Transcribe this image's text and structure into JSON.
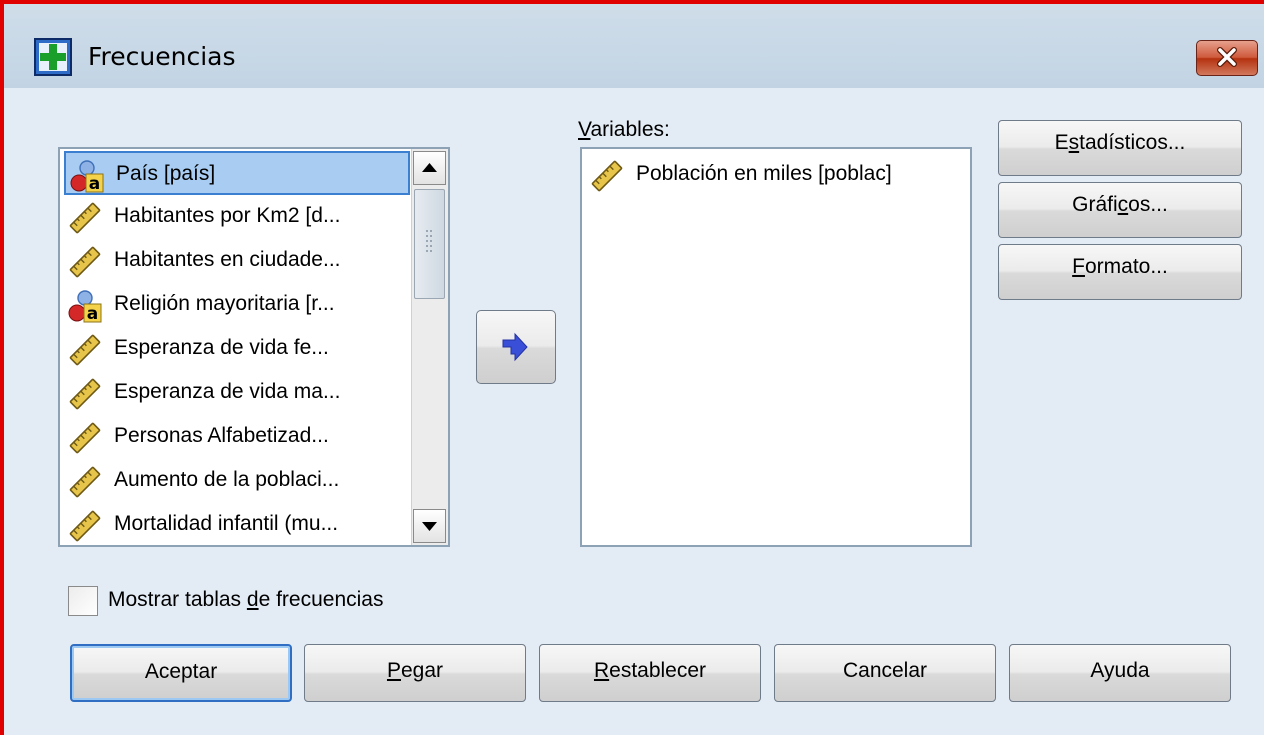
{
  "window": {
    "title": "Frecuencias",
    "icon": "frequencies-icon",
    "close_icon": "close-icon"
  },
  "source_list": {
    "items": [
      {
        "label": "País [país]",
        "icon": "nominal-variable-icon",
        "selected": true
      },
      {
        "label": "Habitantes por Km2 [d...",
        "icon": "scale-variable-icon"
      },
      {
        "label": "Habitantes en ciudade...",
        "icon": "scale-variable-icon"
      },
      {
        "label": "Religión mayoritaria [r...",
        "icon": "nominal-variable-icon"
      },
      {
        "label": "Esperanza de vida fe...",
        "icon": "scale-variable-icon"
      },
      {
        "label": "Esperanza de vida ma...",
        "icon": "scale-variable-icon"
      },
      {
        "label": "Personas Alfabetizad...",
        "icon": "scale-variable-icon"
      },
      {
        "label": "Aumento de la poblaci...",
        "icon": "scale-variable-icon"
      },
      {
        "label": "Mortalidad infantil (mu...",
        "icon": "scale-variable-icon"
      }
    ]
  },
  "move_button": {
    "icon": "arrow-right-icon"
  },
  "variables": {
    "label_pre": "",
    "label_u": "V",
    "label_post": "ariables:",
    "items": [
      {
        "label": "Población en miles [poblac]",
        "icon": "scale-variable-icon"
      }
    ]
  },
  "side_buttons": {
    "stats": {
      "pre": "E",
      "u": "s",
      "post": "tadísticos..."
    },
    "charts": {
      "pre": "Gráfi",
      "u": "c",
      "post": "os..."
    },
    "format": {
      "pre": "",
      "u": "F",
      "post": "ormato..."
    }
  },
  "checkbox": {
    "checked": false,
    "label_pre": "Mostrar tablas ",
    "label_u": "d",
    "label_post": "e frecuencias"
  },
  "bottom_buttons": {
    "accept": {
      "pre": "Aceptar",
      "u": "",
      "post": ""
    },
    "paste": {
      "pre": "",
      "u": "P",
      "post": "egar"
    },
    "reset": {
      "pre": "",
      "u": "R",
      "post": "establecer"
    },
    "cancel": {
      "pre": "Cancelar",
      "u": "",
      "post": ""
    },
    "help": {
      "pre": "Ayuda",
      "u": "",
      "post": ""
    }
  },
  "colors": {
    "border_highlight": "#e00000",
    "dialog_background": "#e3ebf4",
    "selection": "#a9cdf2",
    "close_button": "#c84a2a",
    "arrow": "#3a4fd8"
  }
}
